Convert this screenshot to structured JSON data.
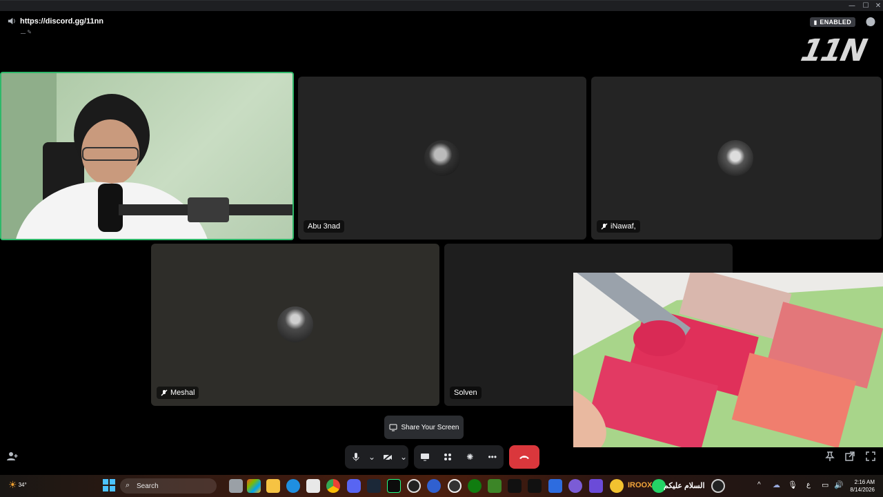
{
  "header": {
    "server_link": "https://discord.gg/11nn",
    "sub_text": "ـــ",
    "badge": "ENABLED",
    "logo": "11N"
  },
  "participants": [
    {
      "name": "Abu 3nad",
      "muted": false
    },
    {
      "name": "iNawaf,",
      "muted": true
    },
    {
      "name": "Meshal",
      "muted": true
    },
    {
      "name": "Solven",
      "muted": false
    }
  ],
  "share_screen": {
    "label": "Share Your Screen"
  },
  "taskbar": {
    "search_placeholder": "Search",
    "weather": "34°",
    "time": "2:16 AM",
    "date": "8/14/2026",
    "lang": "ع",
    "arabic_title": "السلام عليكم",
    "iroox": "IROOX"
  },
  "colors": {
    "speaking_border": "#2fb86a",
    "hangup": "#da373c",
    "tile_bg": "#242424"
  },
  "icons": [
    "speaker-icon",
    "chat-icon",
    "mic-icon",
    "camera-off-icon",
    "screen-share-icon",
    "activities-icon",
    "soundboard-icon",
    "more-icon",
    "hangup-icon",
    "add-user-icon",
    "pin-icon",
    "popout-icon",
    "fullscreen-icon"
  ]
}
